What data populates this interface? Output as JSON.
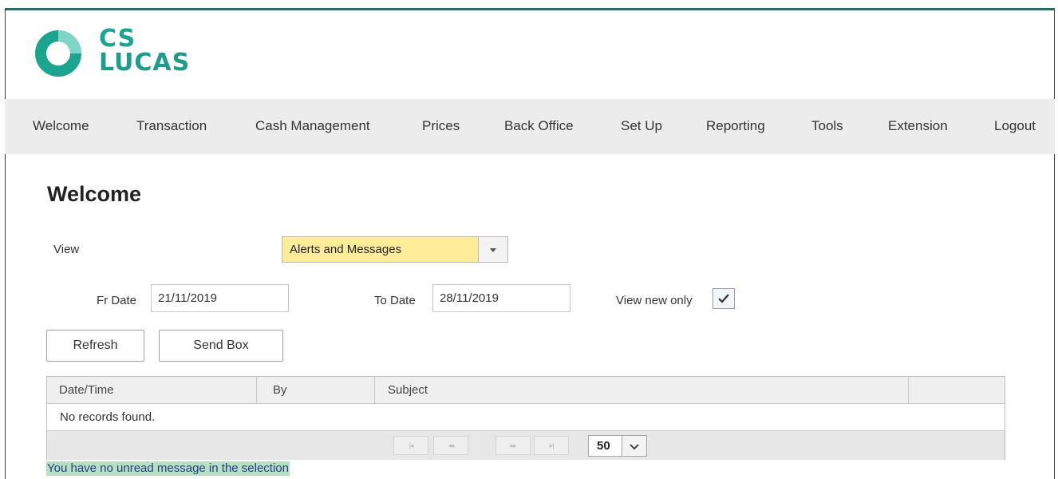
{
  "brand": {
    "line1": "CS",
    "line2": "LUCAS",
    "accent_color": "#1aa58f"
  },
  "nav": {
    "items": [
      "Welcome",
      "Transaction",
      "Cash Management",
      "Prices",
      "Back Office",
      "Set Up",
      "Reporting",
      "Tools",
      "Extension",
      "Logout"
    ]
  },
  "page": {
    "title": "Welcome"
  },
  "filters": {
    "view_label": "View",
    "view_value": "Alerts and Messages",
    "fr_date_label": "Fr Date",
    "fr_date_value": "21/11/2019",
    "to_date_label": "To Date",
    "to_date_value": "28/11/2019",
    "view_new_only_label": "View new only",
    "view_new_only_checked": true
  },
  "actions": {
    "refresh": "Refresh",
    "send_box": "Send Box"
  },
  "grid": {
    "columns": [
      "Date/Time",
      "By",
      "Subject",
      ""
    ],
    "empty_text": "No records found.",
    "page_size": "50"
  },
  "status_message": "You have no unread message in the selection"
}
